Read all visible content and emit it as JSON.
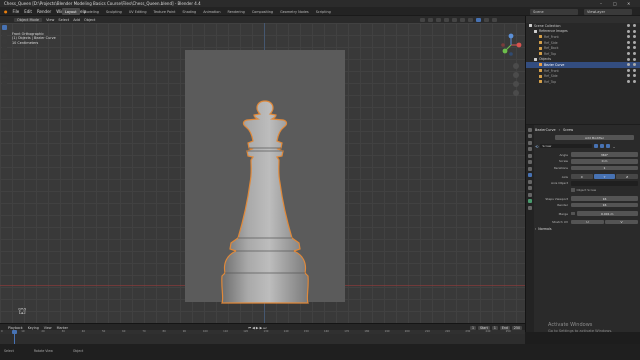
{
  "window": {
    "title": "Chess_Queen [D:\\Projects\\Blender Modeling Basics Course\\Files\\Chess_Queen.blend] - Blender 4.4",
    "controls": [
      "–",
      "□",
      "✕"
    ]
  },
  "menubar": {
    "menus": [
      "File",
      "Edit",
      "Render",
      "Window",
      "Help"
    ],
    "workspaces": [
      "Layout",
      "Modeling",
      "Sculpting",
      "UV Editing",
      "Texture Paint",
      "Shading",
      "Animation",
      "Rendering",
      "Compositing",
      "Geometry Nodes",
      "Scripting"
    ],
    "active_workspace": "Layout",
    "scene": "Scene",
    "view_layer": "ViewLayer"
  },
  "viewport_header": {
    "mode": "Object Mode",
    "menus": [
      "View",
      "Select",
      "Add",
      "Object"
    ]
  },
  "viewport_info": {
    "line1": "Front Orthographic",
    "line2": "(1) Objects | Bezier Curve",
    "line3": "10 Centimeters"
  },
  "outliner": {
    "rows": [
      {
        "label": "Scene Collection",
        "indent": 0,
        "kind": "col",
        "selected": false
      },
      {
        "label": "Reference Images",
        "indent": 1,
        "kind": "col",
        "selected": false
      },
      {
        "label": "Ref_Front",
        "indent": 2,
        "kind": "img",
        "selected": false
      },
      {
        "label": "Ref_Side",
        "indent": 2,
        "kind": "img",
        "selected": false
      },
      {
        "label": "Ref_Back",
        "indent": 2,
        "kind": "img",
        "selected": false
      },
      {
        "label": "Ref_Top",
        "indent": 2,
        "kind": "img",
        "selected": false
      },
      {
        "label": "Objects",
        "indent": 1,
        "kind": "col",
        "selected": false
      },
      {
        "label": "Bezier Curve",
        "indent": 2,
        "kind": "mesh",
        "selected": true
      },
      {
        "label": "Ref_Front",
        "indent": 2,
        "kind": "img",
        "selected": false
      },
      {
        "label": "Ref_Side",
        "indent": 2,
        "kind": "img",
        "selected": false
      },
      {
        "label": "Ref_Top",
        "indent": 2,
        "kind": "img",
        "selected": false
      }
    ]
  },
  "properties": {
    "breadcrumb": [
      "BezierCurve",
      "Screw"
    ],
    "add_modifier": "Add Modifier",
    "modifier_name": "Screw",
    "fields": [
      {
        "label": "Angle",
        "value": "360°"
      },
      {
        "label": "Screw",
        "value": "0 m"
      },
      {
        "label": "Iterations",
        "value": "1"
      }
    ],
    "axis_label": "Axis",
    "axis_options": [
      "X",
      "Y",
      "Z"
    ],
    "axis_selected": "Y",
    "axis_object_label": "Axis Object",
    "object_screw": "Object Screw",
    "steps_viewport_label": "Steps Viewport",
    "steps_viewport": "16",
    "render_label": "Render",
    "render": "16",
    "merge_label": "Merge",
    "merge_value": "0.001 m",
    "stretch_label": "Stretch UV",
    "stretch_u": "U",
    "stretch_v": "V",
    "normals_label": "Normals"
  },
  "timeline": {
    "menus": [
      "Playback",
      "Keying",
      "View",
      "Marker"
    ],
    "ruler": [
      "0",
      "10",
      "20",
      "30",
      "40",
      "50",
      "60",
      "70",
      "80",
      "90",
      "100",
      "110",
      "120",
      "130",
      "140",
      "150",
      "160",
      "170",
      "180",
      "190",
      "200",
      "210",
      "220",
      "230",
      "240",
      "250"
    ],
    "current_frame": "1",
    "start_label": "Start",
    "start": "1",
    "end_label": "End",
    "end": "250"
  },
  "statusbar": {
    "items": [
      "Select",
      "Rotate View",
      "Object"
    ]
  },
  "watermark": {
    "title": "Activate Windows",
    "subtitle": "Go to Settings to activate Windows."
  },
  "colors": {
    "accent": "#4772b3",
    "selection": "#f0a040",
    "viewport_bg": "#393939"
  }
}
